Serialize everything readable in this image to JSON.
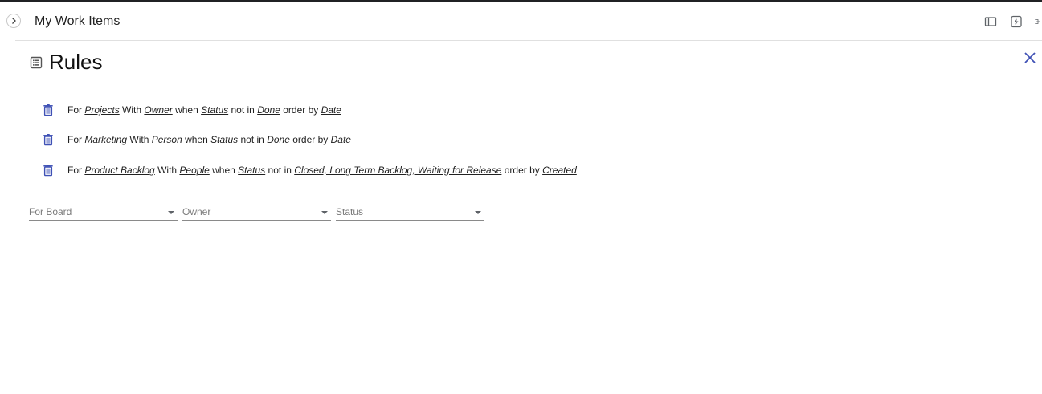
{
  "header": {
    "title": "My Work Items",
    "icons": [
      "sidebar-panel-icon",
      "quick-access-icon",
      "split-icon"
    ]
  },
  "panel": {
    "title": "Rules",
    "title_icon": "list-icon",
    "close_icon": "close-icon"
  },
  "rules": [
    {
      "for_label": "For",
      "board": "Projects",
      "with_label": "With",
      "person_field": "Owner",
      "when_label": "when",
      "status_field": "Status",
      "notin_label": "not in",
      "excluded": "Done",
      "order_label": "order by",
      "order_field": "Date"
    },
    {
      "for_label": "For",
      "board": "Marketing",
      "with_label": "With",
      "person_field": "Person",
      "when_label": "when",
      "status_field": "Status",
      "notin_label": "not in",
      "excluded": "Done",
      "order_label": "order by",
      "order_field": "Date"
    },
    {
      "for_label": "For",
      "board": "Product Backlog",
      "with_label": "With",
      "person_field": "People",
      "when_label": "when",
      "status_field": "Status",
      "notin_label": "not in",
      "excluded": "Closed, Long Term Backlog, Waiting for Release",
      "order_label": "order by",
      "order_field": "Created"
    }
  ],
  "filters": {
    "board_placeholder": "For Board",
    "owner_placeholder": "Owner",
    "status_placeholder": "Status"
  },
  "colors": {
    "accent": "#3f51b5",
    "icon_gray": "#5f6368"
  }
}
